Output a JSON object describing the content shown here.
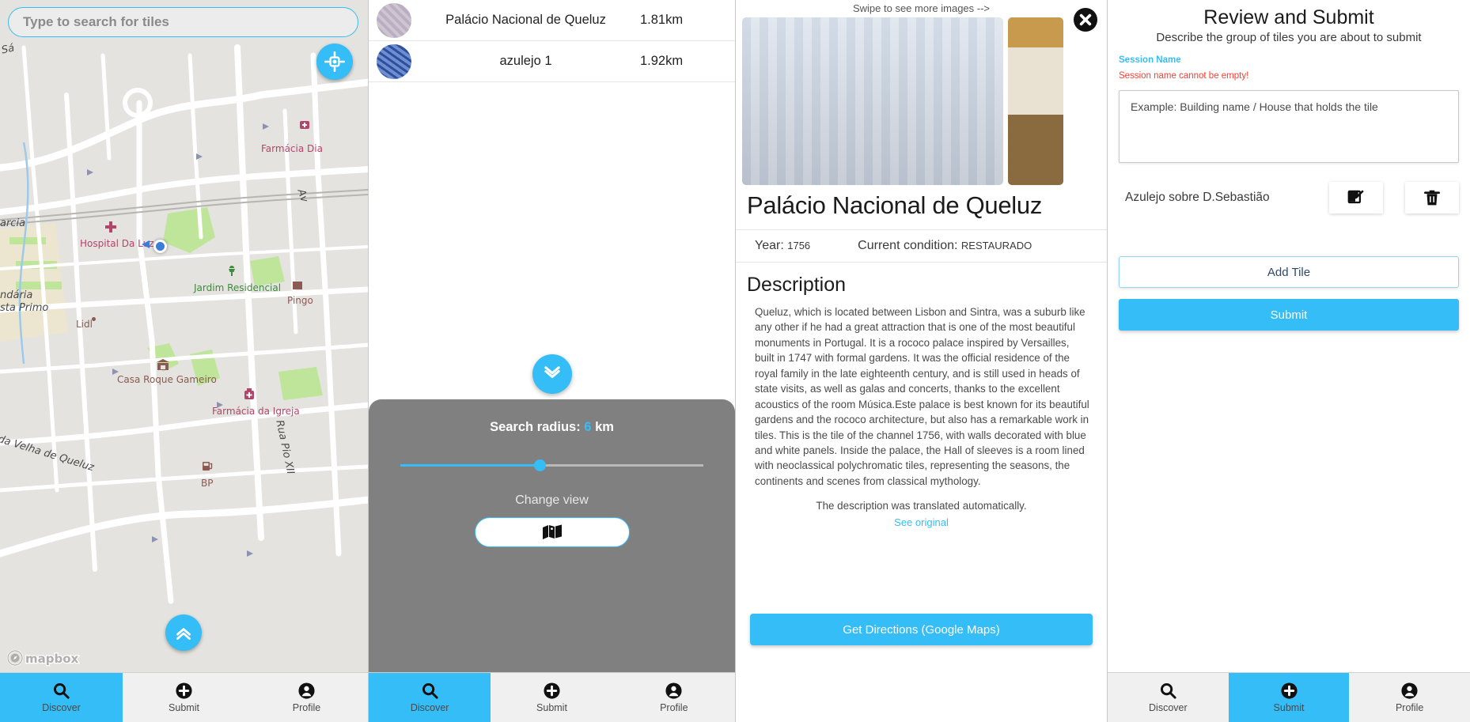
{
  "panel_map": {
    "search": {
      "placeholder": "Type to search for tiles",
      "value": ""
    },
    "locate_icon": "crosshair-icon",
    "expand_icon": "chevrons-up-icon",
    "attribution": "mapbox",
    "labels": [
      {
        "text": "Sá",
        "type": "road"
      },
      {
        "text": "Farmácia Dia",
        "type": "medical"
      },
      {
        "text": "Av",
        "type": "road"
      },
      {
        "text": "arcia",
        "type": "road"
      },
      {
        "text": "Hospital Da Luz",
        "type": "medical"
      },
      {
        "text": "Jardim Residencial",
        "type": "park"
      },
      {
        "text": "Pingo",
        "type": "poi"
      },
      {
        "text": "ndária",
        "type": "road"
      },
      {
        "text": "sta Primo",
        "type": "road"
      },
      {
        "text": "Lidl",
        "type": "poi"
      },
      {
        "text": "Casa Roque Gameiro",
        "type": "poi"
      },
      {
        "text": "Farmácia da Igreja",
        "type": "medical"
      },
      {
        "text": "da Velha de Queluz",
        "type": "road"
      },
      {
        "text": "Rua Pio XII",
        "type": "road"
      },
      {
        "text": "BP",
        "type": "poi"
      }
    ],
    "bottom_nav": [
      {
        "label": "Discover",
        "icon": "search-icon",
        "active": true
      },
      {
        "label": "Submit",
        "icon": "plus-circle-icon",
        "active": false
      },
      {
        "label": "Profile",
        "icon": "person-circle-icon",
        "active": false
      }
    ]
  },
  "panel_list": {
    "rows": [
      {
        "title": "Palácio Nacional de Queluz",
        "distance": "1.81km",
        "thumb": "tile-thumb-purple"
      },
      {
        "title": "azulejo 1",
        "distance": "1.92km",
        "thumb": "tile-thumb-blue"
      }
    ],
    "collapse_icon": "chevrons-down-icon",
    "radius": {
      "label_prefix": "Search radius: ",
      "value": "6",
      "unit": " km",
      "slider_percent": 46,
      "change_view_label": "Change view",
      "map_icon": "map-icon"
    },
    "bottom_nav": [
      {
        "label": "Discover",
        "icon": "search-icon",
        "active": true
      },
      {
        "label": "Submit",
        "icon": "plus-circle-icon",
        "active": false
      },
      {
        "label": "Profile",
        "icon": "person-circle-icon",
        "active": false
      }
    ]
  },
  "panel_detail": {
    "swipe_hint": "Swipe to see more images -->",
    "close_icon": "close-circle-icon",
    "title": "Palácio Nacional de Queluz",
    "year_label": "Year:",
    "year_value": "1756",
    "condition_label": "Current condition:",
    "condition_value": "RESTAURADO",
    "description_heading": "Description",
    "description_body": "Queluz, which is located between Lisbon and Sintra, was a suburb like any other if he had a great attraction that is one of the most beautiful monuments in Portugal. It is a rococo palace inspired by Versailles, built in 1747 with formal gardens. It was the official residence of the royal family in the late eighteenth century, and is still used in heads of state visits, as well as galas and concerts, thanks to the excellent acoustics of the room Música.Este palace is best known for its beautiful gardens and the rococo architecture, but also has a remarkable work in tiles. This is the tile of the channel 1756, with walls decorated with blue and white panels. Inside the palace, the Hall of sleeves is a room lined with neoclassical polychromatic tiles, representing the seasons, the continents and scenes from classical mythology.",
    "translated_note": "The description was translated automatically.",
    "see_original": "See original",
    "directions_button": "Get Directions (Google Maps)"
  },
  "panel_review": {
    "title": "Review and Submit",
    "subtitle": "Describe the group of tiles you are about to submit",
    "field_label": "Session Name",
    "error": "Session name cannot be empty!",
    "textarea_placeholder": "Example: Building name / House that holds the tile",
    "textarea_value": "",
    "tile": {
      "name": "Azulejo sobre D.Sebastião",
      "edit_icon": "edit-square-icon",
      "delete_icon": "trash-icon"
    },
    "add_tile_button": "Add Tile",
    "submit_button": "Submit",
    "bottom_nav": [
      {
        "label": "Discover",
        "icon": "search-icon",
        "active": false
      },
      {
        "label": "Submit",
        "icon": "plus-circle-icon",
        "active": true
      },
      {
        "label": "Profile",
        "icon": "person-circle-icon",
        "active": false
      }
    ]
  },
  "colors": {
    "accent": "#35bdf7",
    "error": "#ff3b30",
    "sheet": "#808080",
    "map_background": "#e5e3df"
  }
}
